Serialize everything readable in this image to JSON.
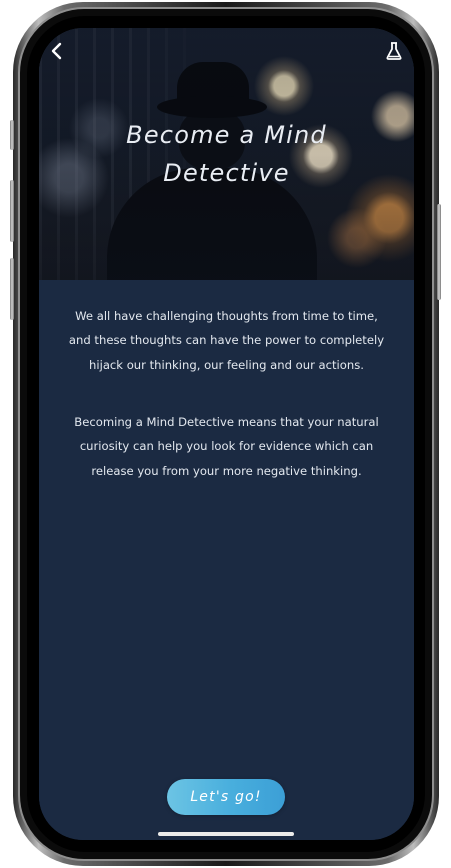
{
  "header": {
    "title_line1": "Become a Mind",
    "title_line2": "Detective",
    "back_icon": "chevron-left-icon",
    "right_icon": "flask-icon"
  },
  "body": {
    "paragraph1": "We all have challenging thoughts from time to time, and these thoughts can have the power to completely hijack our thinking, our feeling and our actions.",
    "paragraph2": "Becoming a Mind Detective means that your natural curiosity can help you look for evidence which can release you from your more negative thinking."
  },
  "cta": {
    "label": "Let's go!"
  },
  "colors": {
    "background": "#1b2a42",
    "button_start": "#6cc4e4",
    "button_end": "#3c9fd6",
    "text": "#e3e8ef"
  }
}
